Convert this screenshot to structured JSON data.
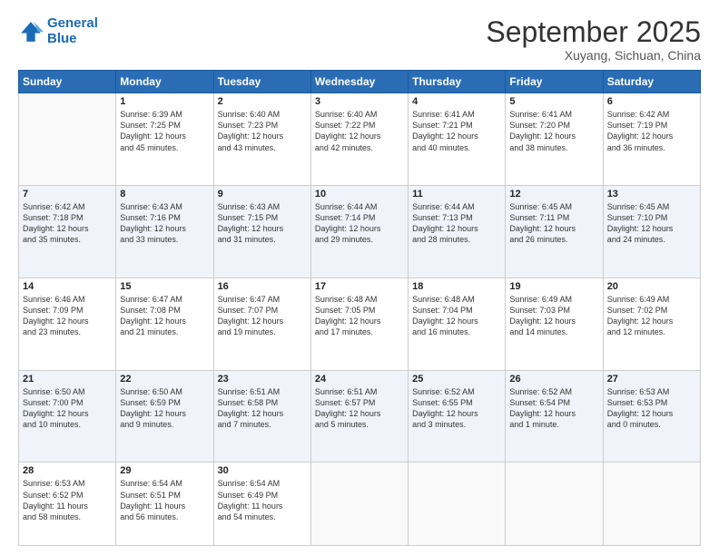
{
  "header": {
    "logo_line1": "General",
    "logo_line2": "Blue",
    "month": "September 2025",
    "location": "Xuyang, Sichuan, China"
  },
  "weekdays": [
    "Sunday",
    "Monday",
    "Tuesday",
    "Wednesday",
    "Thursday",
    "Friday",
    "Saturday"
  ],
  "rows": [
    [
      {
        "day": "",
        "text": ""
      },
      {
        "day": "1",
        "text": "Sunrise: 6:39 AM\nSunset: 7:25 PM\nDaylight: 12 hours\nand 45 minutes."
      },
      {
        "day": "2",
        "text": "Sunrise: 6:40 AM\nSunset: 7:23 PM\nDaylight: 12 hours\nand 43 minutes."
      },
      {
        "day": "3",
        "text": "Sunrise: 6:40 AM\nSunset: 7:22 PM\nDaylight: 12 hours\nand 42 minutes."
      },
      {
        "day": "4",
        "text": "Sunrise: 6:41 AM\nSunset: 7:21 PM\nDaylight: 12 hours\nand 40 minutes."
      },
      {
        "day": "5",
        "text": "Sunrise: 6:41 AM\nSunset: 7:20 PM\nDaylight: 12 hours\nand 38 minutes."
      },
      {
        "day": "6",
        "text": "Sunrise: 6:42 AM\nSunset: 7:19 PM\nDaylight: 12 hours\nand 36 minutes."
      }
    ],
    [
      {
        "day": "7",
        "text": "Sunrise: 6:42 AM\nSunset: 7:18 PM\nDaylight: 12 hours\nand 35 minutes."
      },
      {
        "day": "8",
        "text": "Sunrise: 6:43 AM\nSunset: 7:16 PM\nDaylight: 12 hours\nand 33 minutes."
      },
      {
        "day": "9",
        "text": "Sunrise: 6:43 AM\nSunset: 7:15 PM\nDaylight: 12 hours\nand 31 minutes."
      },
      {
        "day": "10",
        "text": "Sunrise: 6:44 AM\nSunset: 7:14 PM\nDaylight: 12 hours\nand 29 minutes."
      },
      {
        "day": "11",
        "text": "Sunrise: 6:44 AM\nSunset: 7:13 PM\nDaylight: 12 hours\nand 28 minutes."
      },
      {
        "day": "12",
        "text": "Sunrise: 6:45 AM\nSunset: 7:11 PM\nDaylight: 12 hours\nand 26 minutes."
      },
      {
        "day": "13",
        "text": "Sunrise: 6:45 AM\nSunset: 7:10 PM\nDaylight: 12 hours\nand 24 minutes."
      }
    ],
    [
      {
        "day": "14",
        "text": "Sunrise: 6:46 AM\nSunset: 7:09 PM\nDaylight: 12 hours\nand 23 minutes."
      },
      {
        "day": "15",
        "text": "Sunrise: 6:47 AM\nSunset: 7:08 PM\nDaylight: 12 hours\nand 21 minutes."
      },
      {
        "day": "16",
        "text": "Sunrise: 6:47 AM\nSunset: 7:07 PM\nDaylight: 12 hours\nand 19 minutes."
      },
      {
        "day": "17",
        "text": "Sunrise: 6:48 AM\nSunset: 7:05 PM\nDaylight: 12 hours\nand 17 minutes."
      },
      {
        "day": "18",
        "text": "Sunrise: 6:48 AM\nSunset: 7:04 PM\nDaylight: 12 hours\nand 16 minutes."
      },
      {
        "day": "19",
        "text": "Sunrise: 6:49 AM\nSunset: 7:03 PM\nDaylight: 12 hours\nand 14 minutes."
      },
      {
        "day": "20",
        "text": "Sunrise: 6:49 AM\nSunset: 7:02 PM\nDaylight: 12 hours\nand 12 minutes."
      }
    ],
    [
      {
        "day": "21",
        "text": "Sunrise: 6:50 AM\nSunset: 7:00 PM\nDaylight: 12 hours\nand 10 minutes."
      },
      {
        "day": "22",
        "text": "Sunrise: 6:50 AM\nSunset: 6:59 PM\nDaylight: 12 hours\nand 9 minutes."
      },
      {
        "day": "23",
        "text": "Sunrise: 6:51 AM\nSunset: 6:58 PM\nDaylight: 12 hours\nand 7 minutes."
      },
      {
        "day": "24",
        "text": "Sunrise: 6:51 AM\nSunset: 6:57 PM\nDaylight: 12 hours\nand 5 minutes."
      },
      {
        "day": "25",
        "text": "Sunrise: 6:52 AM\nSunset: 6:55 PM\nDaylight: 12 hours\nand 3 minutes."
      },
      {
        "day": "26",
        "text": "Sunrise: 6:52 AM\nSunset: 6:54 PM\nDaylight: 12 hours\nand 1 minute."
      },
      {
        "day": "27",
        "text": "Sunrise: 6:53 AM\nSunset: 6:53 PM\nDaylight: 12 hours\nand 0 minutes."
      }
    ],
    [
      {
        "day": "28",
        "text": "Sunrise: 6:53 AM\nSunset: 6:52 PM\nDaylight: 11 hours\nand 58 minutes."
      },
      {
        "day": "29",
        "text": "Sunrise: 6:54 AM\nSunset: 6:51 PM\nDaylight: 11 hours\nand 56 minutes."
      },
      {
        "day": "30",
        "text": "Sunrise: 6:54 AM\nSunset: 6:49 PM\nDaylight: 11 hours\nand 54 minutes."
      },
      {
        "day": "",
        "text": ""
      },
      {
        "day": "",
        "text": ""
      },
      {
        "day": "",
        "text": ""
      },
      {
        "day": "",
        "text": ""
      }
    ]
  ]
}
